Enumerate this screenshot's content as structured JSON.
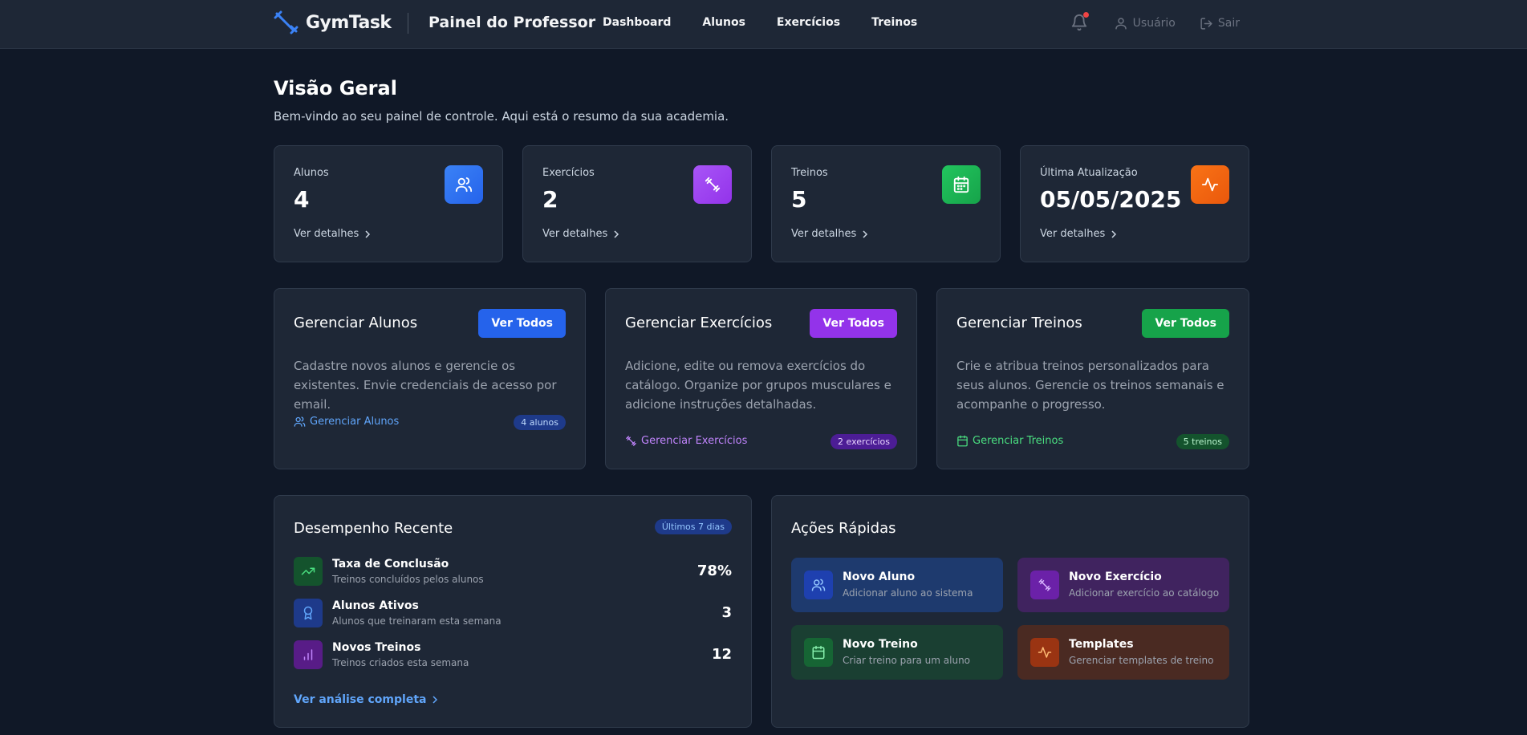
{
  "header": {
    "logo_text": "GymTask",
    "panel_title": "Painel do Professor",
    "nav": [
      "Dashboard",
      "Alunos",
      "Exercícios",
      "Treinos"
    ],
    "user_label": "Usuário",
    "logout_label": "Sair"
  },
  "page": {
    "title": "Visão Geral",
    "subtitle": "Bem-vindo ao seu painel de controle. Aqui está o resumo da sua academia."
  },
  "stats": [
    {
      "label": "Alunos",
      "value": "4",
      "link": "Ver detalhes",
      "icon": "users-icon",
      "color": "#3b82f6"
    },
    {
      "label": "Exercícios",
      "value": "2",
      "link": "Ver detalhes",
      "icon": "dumbbell-icon",
      "color": "#a855f7"
    },
    {
      "label": "Treinos",
      "value": "5",
      "link": "Ver detalhes",
      "icon": "calendar-icon",
      "color": "#22c55e"
    },
    {
      "label": "Última Atualização",
      "value": "05/05/2025",
      "link": "Ver detalhes",
      "icon": "activity-icon",
      "color": "#f97316"
    }
  ],
  "manage": [
    {
      "title": "Gerenciar Alunos",
      "button": "Ver Todos",
      "description": "Cadastre novos alunos e gerencie os existentes. Envie credenciais de acesso por email.",
      "link": "Gerenciar Alunos",
      "badge": "4 alunos",
      "accent": "#2563eb"
    },
    {
      "title": "Gerenciar Exercícios",
      "button": "Ver Todos",
      "description": "Adicione, edite ou remova exercícios do catálogo. Organize por grupos musculares e adicione instruções detalhadas.",
      "link": "Gerenciar Exercícios",
      "badge": "2 exercícios",
      "accent": "#9333ea"
    },
    {
      "title": "Gerenciar Treinos",
      "button": "Ver Todos",
      "description": "Crie e atribua treinos personalizados para seus alunos. Gerencie os treinos semanais e acompanhe o progresso.",
      "link": "Gerenciar Treinos",
      "badge": "5 treinos",
      "accent": "#16a34a"
    }
  ],
  "performance": {
    "title": "Desempenho Recente",
    "period": "Últimos 7 dias",
    "rows": [
      {
        "name": "Taxa de Conclusão",
        "sub": "Treinos concluídos pelos alunos",
        "value": "78%",
        "icon": "trending-up-icon"
      },
      {
        "name": "Alunos Ativos",
        "sub": "Alunos que treinaram esta semana",
        "value": "3",
        "icon": "award-icon"
      },
      {
        "name": "Novos Treinos",
        "sub": "Treinos criados esta semana",
        "value": "12",
        "icon": "bar-chart-icon"
      }
    ],
    "more": "Ver análise completa"
  },
  "quick_actions": {
    "title": "Ações Rápidas",
    "items": [
      {
        "name": "Novo Aluno",
        "sub": "Adicionar aluno ao sistema",
        "icon": "users-icon"
      },
      {
        "name": "Novo Exercício",
        "sub": "Adicionar exercício ao catálogo",
        "icon": "dumbbell-icon"
      },
      {
        "name": "Novo Treino",
        "sub": "Criar treino para um aluno",
        "icon": "calendar-icon"
      },
      {
        "name": "Templates",
        "sub": "Gerenciar templates de treino",
        "icon": "activity-icon"
      }
    ]
  }
}
